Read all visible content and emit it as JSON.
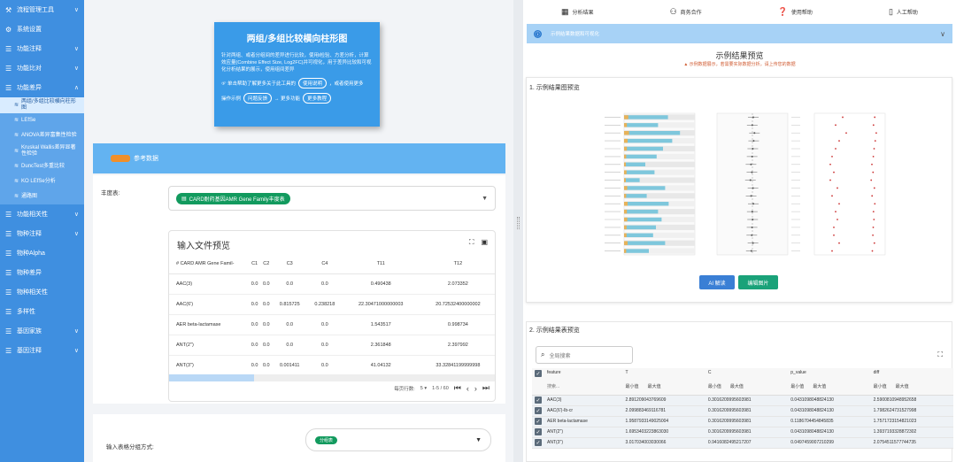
{
  "sidebar": {
    "items": [
      {
        "icon": "wrench-icon",
        "label": "流程管理工具",
        "chev": "∨"
      },
      {
        "icon": "link-icon",
        "label": "系统设置"
      },
      {
        "icon": "list-icon",
        "label": "功能注释",
        "chev": "∨"
      },
      {
        "icon": "list-icon",
        "label": "功能比对",
        "chev": "∨"
      },
      {
        "icon": "list-icon",
        "label": "功能差异",
        "chev": "∧"
      }
    ],
    "subitems": [
      {
        "label": "两组/多组比较横向柱形图",
        "active": true
      },
      {
        "label": "LEfSe"
      },
      {
        "label": "ANOVA差异富集性检验"
      },
      {
        "label": "Kruskal Wallis差异显著性检验"
      },
      {
        "label": "DuncTest多重比较"
      },
      {
        "label": "KO LEfSe分析"
      },
      {
        "label": "通路图"
      }
    ],
    "items_after": [
      {
        "icon": "list-icon",
        "label": "功能相关性",
        "chev": "∨"
      },
      {
        "icon": "list-icon",
        "label": "物种注释",
        "chev": "∨"
      },
      {
        "icon": "list-icon",
        "label": "物种Alpha"
      },
      {
        "icon": "list-icon",
        "label": "物种差异"
      },
      {
        "icon": "list-icon",
        "label": "物种相关性"
      },
      {
        "icon": "list-icon",
        "label": "多样性"
      },
      {
        "icon": "list-icon",
        "label": "基因家族",
        "chev": "∨"
      },
      {
        "icon": "list-icon",
        "label": "基因注释",
        "chev": "∨"
      }
    ]
  },
  "tool_card": {
    "title": "两组/多组比较横向柱形图",
    "desc": "针对两组、或者分组间的差异进行比较，使用t检验、方差分析，计算效应量(Combine Effect Size, Log2FC)并可视化，用于差异比较和可视化分析结果的展示，使用组间差异",
    "row1_prefix": "☞ 单击帮助了解更多关于此工具的",
    "row1_pill": "使用说明",
    "row1_suffix": "，或者使用更多",
    "row2_prefix": "操作示例",
    "row2_pill1": "问题反馈",
    "row2_mid": "→ 更多功能",
    "row2_pill2": "更多教程"
  },
  "ref_bar": {
    "label": "参考数据"
  },
  "input": {
    "label": "丰度表:",
    "chip": "CARD耐药基因AMR Gene Family丰度表",
    "preview_title": "输入文件预览",
    "columns": [
      "# CARD AMR Gene Famil-",
      "C1",
      "C2",
      "C3",
      "C4",
      "T11",
      "T12"
    ],
    "rows": [
      [
        "AAC(3)",
        "0.0",
        "0.0",
        "0.0",
        "0.0",
        "0.490438",
        "2.073352"
      ],
      [
        "AAC(6')",
        "0.0",
        "0.0",
        "0.815725",
        "0.238218",
        "22.30471000000003",
        "20.72532400000002"
      ],
      [
        "AER beta-lactamase",
        "0.0",
        "0.0",
        "0.0",
        "0.0",
        "1.543517",
        "0.998734"
      ],
      [
        "ANT(2'')",
        "0.0",
        "0.0",
        "0.0",
        "0.0",
        "2.361848",
        "2.397992"
      ],
      [
        "ANT(3'')",
        "0.0",
        "0.0",
        "0.001411",
        "0.0",
        "41.04132",
        "33.32841199999998"
      ]
    ],
    "pager_label": "每页行数:",
    "pager_size": "5",
    "pager_range": "1-5 / 60"
  },
  "input2": {
    "label": "输入表格分组方式:",
    "chip": "分组表"
  },
  "right": {
    "tabs": [
      {
        "icon": "grid-icon",
        "label": "分析结果"
      },
      {
        "icon": "handshake-icon",
        "label": "商务合作"
      },
      {
        "icon": "help-icon",
        "label": "使用帮助"
      },
      {
        "icon": "phone-icon",
        "label": "人工帮助"
      }
    ],
    "accordion": "示例结果数据和可视化",
    "example_title": "示例结果预览",
    "example_warning": "▲ 示例数据展示，若需要实际数据分析，请上传您的数据",
    "fig_section": "1. 示例结果图预览",
    "btn_ai": "AI 解读",
    "btn_edit": "编辑图片",
    "tbl_section": "2. 示例结果表预览",
    "search_placeholder": "全局搜索",
    "columns": [
      "feature",
      "T",
      "C",
      "p_value",
      "diff"
    ],
    "col_filter": "搜索...",
    "min_label": "最小值",
    "max_label": "最大值",
    "rows": [
      [
        "AAC(3)",
        "2.891209043769609",
        "0.3016209995603981",
        "0.0431098048824130",
        "2.5900810948952658"
      ],
      [
        "AAC(6')-Ib-cr",
        "2.099883469116781",
        "0.3016209995603981",
        "0.0431098048824130",
        "1.7982624731527998"
      ],
      [
        "AER beta-lactamase",
        "1.9587933149025004",
        "0.3016209995603981",
        "0.1186704454845835",
        "1.7571723154821023"
      ],
      [
        "ANT(2'')",
        "1.6953403223863030",
        "0.3016209995603981",
        "0.0431098048824130",
        "1.3937193328872302"
      ],
      [
        "ANT(3'')",
        "3.017034003030066",
        "0.9416082495217207",
        "0.0497459007210299",
        "2.0754511577744735"
      ]
    ]
  },
  "chart_data": {
    "type": "bar",
    "series": [
      {
        "values": [
          0.62,
          0.48,
          0.79,
          0.68,
          0.55,
          0.46,
          0.3,
          0.43,
          0.22,
          0.58,
          0.32,
          0.63,
          0.48,
          0.53,
          0.45,
          0.41,
          0.58,
          0.35
        ]
      },
      {
        "values": [
          0.12,
          0.08,
          0.14,
          0.1,
          0.08,
          0.06,
          0.05,
          0.07,
          0.05,
          0.09,
          0.06,
          0.1,
          0.08,
          0.09,
          0.07,
          0.07,
          0.1,
          0.06
        ]
      }
    ],
    "colors": [
      "#7ec7dc",
      "#e7b25a"
    ]
  }
}
